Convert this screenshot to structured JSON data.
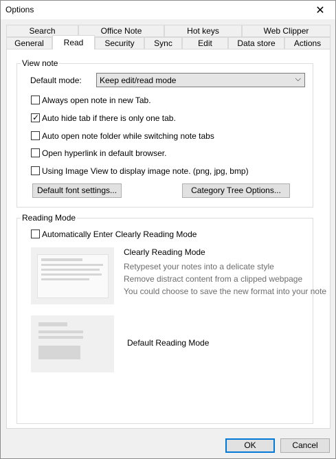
{
  "window": {
    "title": "Options"
  },
  "tabs_top": [
    {
      "label": "Search"
    },
    {
      "label": "Office Note"
    },
    {
      "label": "Hot keys"
    },
    {
      "label": "Web Clipper"
    }
  ],
  "tabs_bottom": [
    {
      "label": "General"
    },
    {
      "label": "Read"
    },
    {
      "label": "Security"
    },
    {
      "label": "Sync"
    },
    {
      "label": "Edit"
    },
    {
      "label": "Data store"
    },
    {
      "label": "Actions"
    }
  ],
  "view_note": {
    "title": "View note",
    "default_mode_label": "Default mode:",
    "default_mode_value": "Keep edit/read mode",
    "options": [
      {
        "label": "Always open note in new Tab.",
        "checked": false
      },
      {
        "label": "Auto hide tab if there is only one tab.",
        "checked": true
      },
      {
        "label": "Auto open note folder while switching note tabs",
        "checked": false
      },
      {
        "label": "Open hyperlink in default browser.",
        "checked": false
      },
      {
        "label": "Using Image View to display image note. (png, jpg, bmp)",
        "checked": false
      }
    ],
    "font_button": "Default font settings...",
    "category_button": "Category Tree  Options..."
  },
  "reading_mode": {
    "title": "Reading Mode",
    "auto_enter_label": "Automatically Enter Clearly Reading Mode",
    "auto_enter_checked": false,
    "clearly_title": "Clearly Reading Mode",
    "clearly_lines": [
      "Retypeset your notes into a delicate style",
      "Remove distract content from a clipped webpage",
      "You could choose to save the new format into your note"
    ],
    "default_title": "Default Reading Mode"
  },
  "footer": {
    "ok": "OK",
    "cancel": "Cancel"
  }
}
